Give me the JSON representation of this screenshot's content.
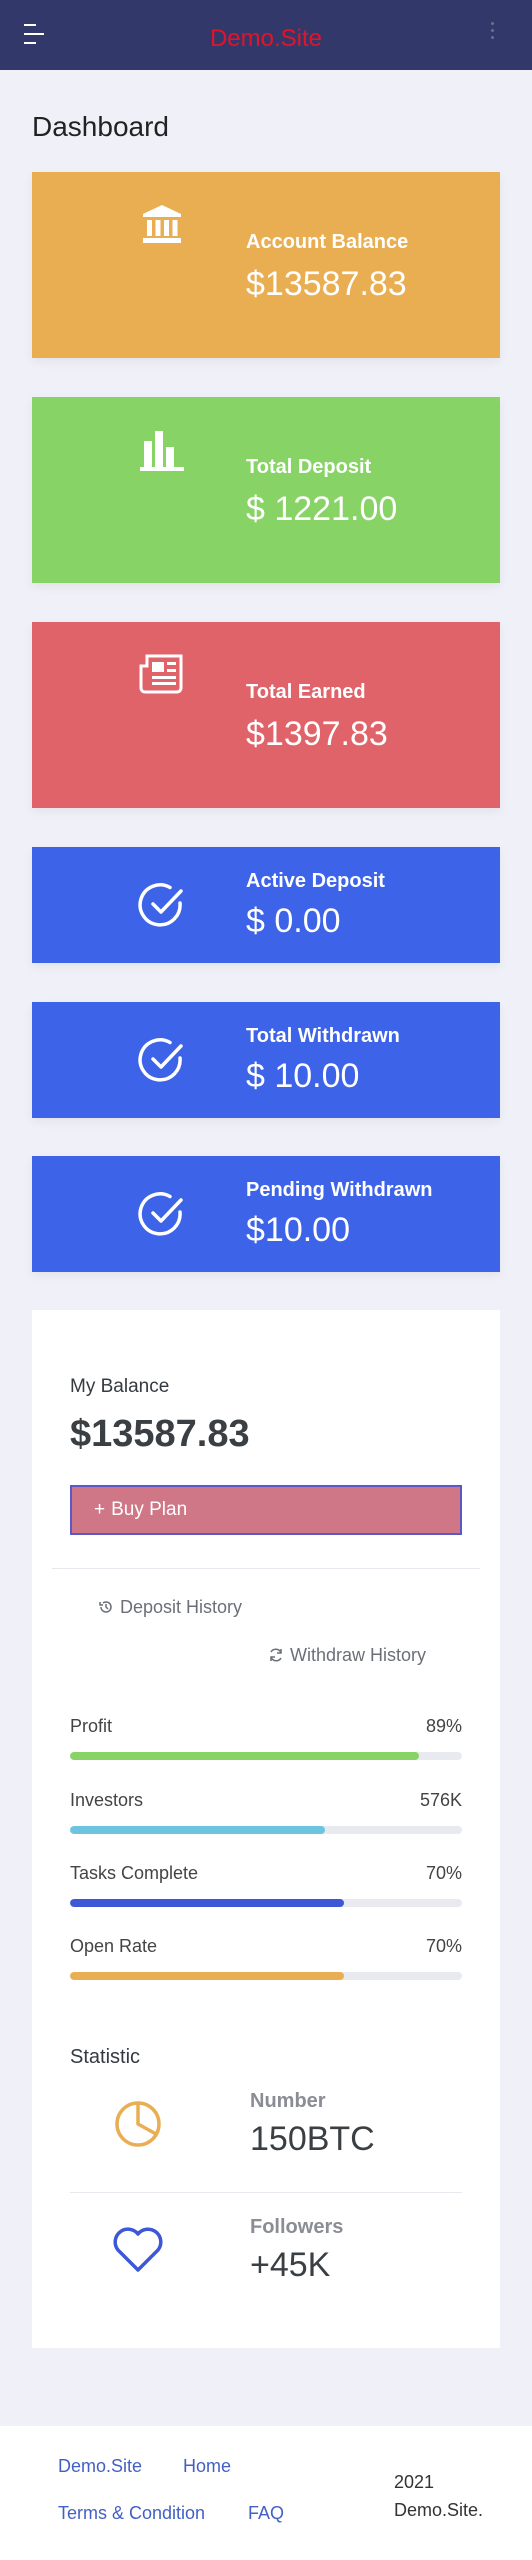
{
  "header": {
    "brand": "Demo.Site"
  },
  "page": {
    "title": "Dashboard"
  },
  "cards": [
    {
      "label": "Account Balance",
      "value": "$13587.83",
      "color": "#eaae52",
      "icon": "bank-icon"
    },
    {
      "label": "Total Deposit",
      "value": "$ 1221.00",
      "color": "#88d366",
      "icon": "bar-chart-icon"
    },
    {
      "label": "Total Earned",
      "value": "$1397.83",
      "color": "#e0636a",
      "icon": "newspaper-icon"
    },
    {
      "label": "Active Deposit",
      "value": "$ 0.00",
      "color": "#3d63e8",
      "icon": "check-circle-icon"
    },
    {
      "label": "Total Withdrawn",
      "value": "$ 10.00",
      "color": "#3d63e8",
      "icon": "check-circle-icon"
    },
    {
      "label": "Pending Withdrawn",
      "value": "$10.00",
      "color": "#3d63e8",
      "icon": "check-circle-icon"
    }
  ],
  "balance": {
    "title": "My Balance",
    "amount": "$13587.83",
    "buy_label": "Buy Plan",
    "deposit_history": "Deposit History",
    "withdraw_history": "Withdraw History"
  },
  "progress": [
    {
      "label": "Profit",
      "value": "89%",
      "fraction": 0.89,
      "color": "#88d366"
    },
    {
      "label": "Investors",
      "value": "576K",
      "fraction": 0.65,
      "color": "#6cc4e0"
    },
    {
      "label": "Tasks Complete",
      "value": "70%",
      "fraction": 0.7,
      "color": "#3d57d6"
    },
    {
      "label": "Open Rate",
      "value": "70%",
      "fraction": 0.7,
      "color": "#eaae52"
    }
  ],
  "statistic": {
    "title": "Statistic",
    "items": [
      {
        "label": "Number",
        "value": "150BTC",
        "icon": "pie-chart-icon",
        "color": "#eaae52"
      },
      {
        "label": "Followers",
        "value": "+45K",
        "icon": "heart-icon",
        "color": "#3d57d6"
      }
    ]
  },
  "footer": {
    "links": [
      "Demo.Site",
      "Home",
      "Terms & Condition",
      "FAQ"
    ],
    "copyright_year": "2021",
    "copyright_name": "Demo.Site."
  }
}
